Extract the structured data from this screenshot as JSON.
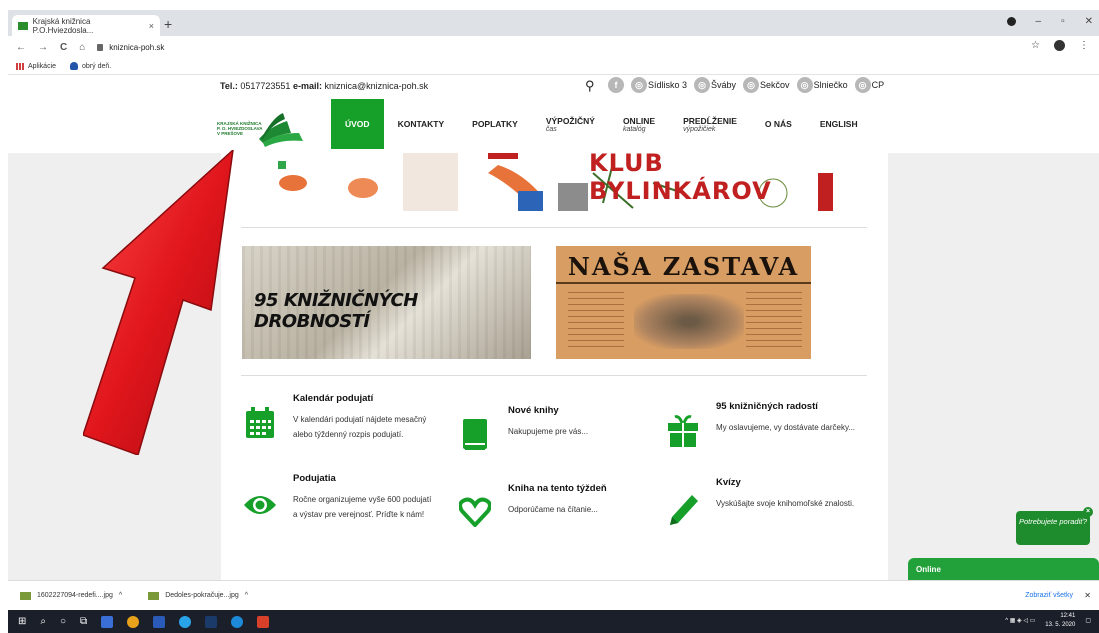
{
  "browser": {
    "tab_title": "Krajská knižnica P.O.Hviezdosla...",
    "tab_close": "×",
    "new_tab": "+",
    "url": "kniznica-poh.sk",
    "bookmarks": [
      {
        "label": "Aplikácie",
        "icon": "apps-grid-icon"
      },
      {
        "label": "obrý deň.",
        "icon": "person-icon"
      }
    ],
    "nav_glyphs": {
      "back": "←",
      "forward": "→",
      "reload": "C",
      "home": "⌂"
    },
    "window": {
      "minimize": "–",
      "maximize": "▫",
      "close": "✕"
    }
  },
  "contact": {
    "tel_label": "Tel.:",
    "tel": "0517723551",
    "email_label": "e-mail:",
    "email": "kniznica@kniznica-poh.sk",
    "search_icon": "🔍"
  },
  "socials": [
    {
      "label": "",
      "icon": "facebook-icon",
      "glyph": "f"
    },
    {
      "label": "Sídlisko 3",
      "icon": "instagram-icon",
      "glyph": "◎"
    },
    {
      "label": "Šváby",
      "icon": "instagram-icon",
      "glyph": "◎"
    },
    {
      "label": "Sekčov",
      "icon": "instagram-icon",
      "glyph": "◎"
    },
    {
      "label": "Slniečko",
      "icon": "instagram-icon",
      "glyph": "◎"
    },
    {
      "label": "CP",
      "icon": "instagram-icon",
      "glyph": "◎"
    }
  ],
  "logo": {
    "line1": "KRAJSKÁ KNIŽNICA",
    "line2": "P. O. HVIEZDOSLAVA",
    "line3": "V PREŠOVE"
  },
  "nav": [
    {
      "label": "ÚVOD",
      "sub": "",
      "active": true
    },
    {
      "label": "KONTAKTY",
      "sub": "",
      "active": false
    },
    {
      "label": "POPLATKY",
      "sub": "",
      "active": false
    },
    {
      "label": "VÝPOŽIČNÝ",
      "sub": "čas",
      "active": false
    },
    {
      "label": "ONLINE",
      "sub": "katalóg",
      "active": false
    },
    {
      "label": "PREDĹŽENIE",
      "sub": "výpožičiek",
      "active": false
    },
    {
      "label": "O NÁS",
      "sub": "",
      "active": false
    },
    {
      "label": "ENGLISH",
      "sub": "",
      "active": false
    }
  ],
  "banner": {
    "title": "KLUB BYLINKÁROV"
  },
  "cards": {
    "left_text": "95 KNIŽNIČNÝCH DROBNOSTÍ",
    "right_title": "NAŠA ZASTAVA"
  },
  "features": [
    {
      "title": "Kalendár podujatí",
      "text": "V kalendári podujatí nájdete mesačný alebo týždenný rozpis podujatí.",
      "icon": "calendar-icon"
    },
    {
      "title": "Nové knihy",
      "text": "Nakupujeme pre vás...",
      "icon": "book-icon"
    },
    {
      "title": "95 knižničných radostí",
      "text": "My oslavujeme, vy dostávate darčeky...",
      "icon": "gift-icon"
    },
    {
      "title": "Podujatia",
      "text": "Ročne organizujeme vyše 600 podujatí a výstav pre verejnosť. Príďte k nám!",
      "icon": "eye-icon"
    },
    {
      "title": "Kniha na tento týždeň",
      "text": "Odporúčame na čítanie...",
      "icon": "heart-icon"
    },
    {
      "title": "Kvízy",
      "text": "Vyskúšajte svoje knihomoľské znalosti.",
      "icon": "pencil-icon"
    }
  ],
  "chat": {
    "bubble": "Potrebujete poradiť?",
    "close": "×",
    "online": "Online"
  },
  "downloads": {
    "items": [
      "1602227094-redefi....jpg",
      "Dedoles-pokračuje...jpg"
    ],
    "chevron": "^",
    "show_all": "Zobraziť všetky",
    "close": "✕"
  },
  "taskbar": {
    "time": "12:41",
    "date": "13. 5. 2020"
  },
  "colors": {
    "brand_green": "#16a02a",
    "arrow_red": "#e0161c"
  }
}
